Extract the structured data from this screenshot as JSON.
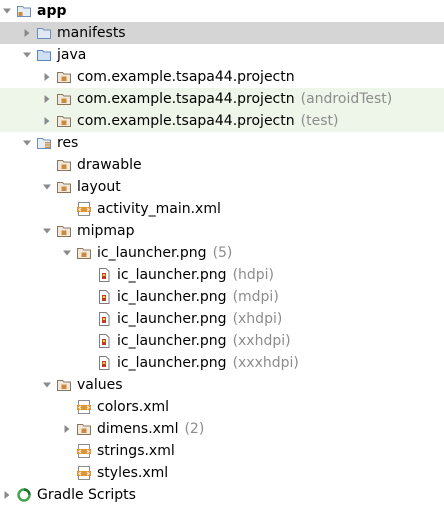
{
  "colors": {
    "selected_row": "#d5d5d5",
    "test_row_highlight": "#eef6e9",
    "folder_outline": "#6e8fb5",
    "module_square": "#ce8a3c",
    "gradle_green": "#3ea64b",
    "secondary_text": "#8c8c8c"
  },
  "tree": [
    {
      "id": "app",
      "label": "app",
      "suffix": "",
      "icon": "module-folder-icon",
      "arrow": "expanded",
      "depth": 0,
      "bold": true,
      "state": ""
    },
    {
      "id": "manifests",
      "label": "manifests",
      "suffix": "",
      "icon": "folder-icon",
      "arrow": "collapsed",
      "depth": 1,
      "bold": false,
      "state": "selected"
    },
    {
      "id": "java",
      "label": "java",
      "suffix": "",
      "icon": "source-folder-icon",
      "arrow": "expanded",
      "depth": 1,
      "bold": false,
      "state": ""
    },
    {
      "id": "pkg-main",
      "label": "com.example.tsapa44.projectn",
      "suffix": "",
      "icon": "package-icon",
      "arrow": "collapsed",
      "depth": 2,
      "bold": false,
      "state": ""
    },
    {
      "id": "pkg-android-test",
      "label": "com.example.tsapa44.projectn",
      "suffix": "(androidTest)",
      "icon": "package-icon",
      "arrow": "collapsed",
      "depth": 2,
      "bold": false,
      "state": "highlight"
    },
    {
      "id": "pkg-test",
      "label": "com.example.tsapa44.projectn",
      "suffix": "(test)",
      "icon": "package-icon",
      "arrow": "collapsed",
      "depth": 2,
      "bold": false,
      "state": "highlight"
    },
    {
      "id": "res",
      "label": "res",
      "suffix": "",
      "icon": "resource-folder-icon",
      "arrow": "expanded",
      "depth": 1,
      "bold": false,
      "state": ""
    },
    {
      "id": "drawable",
      "label": "drawable",
      "suffix": "",
      "icon": "package-icon",
      "arrow": "none",
      "depth": 2,
      "bold": false,
      "state": ""
    },
    {
      "id": "layout",
      "label": "layout",
      "suffix": "",
      "icon": "package-icon",
      "arrow": "expanded",
      "depth": 2,
      "bold": false,
      "state": ""
    },
    {
      "id": "activity-main",
      "label": "activity_main.xml",
      "suffix": "",
      "icon": "xml-file-icon",
      "arrow": "none",
      "depth": 3,
      "bold": false,
      "state": ""
    },
    {
      "id": "mipmap",
      "label": "mipmap",
      "suffix": "",
      "icon": "package-icon",
      "arrow": "expanded",
      "depth": 2,
      "bold": false,
      "state": ""
    },
    {
      "id": "ic-launcher-group",
      "label": "ic_launcher.png",
      "suffix": "(5)",
      "icon": "package-icon",
      "arrow": "expanded",
      "depth": 3,
      "bold": false,
      "state": ""
    },
    {
      "id": "ic-hdpi",
      "label": "ic_launcher.png",
      "suffix": "(hdpi)",
      "icon": "image-file-icon",
      "arrow": "none",
      "depth": 4,
      "bold": false,
      "state": ""
    },
    {
      "id": "ic-mdpi",
      "label": "ic_launcher.png",
      "suffix": "(mdpi)",
      "icon": "image-file-icon",
      "arrow": "none",
      "depth": 4,
      "bold": false,
      "state": ""
    },
    {
      "id": "ic-xhdpi",
      "label": "ic_launcher.png",
      "suffix": "(xhdpi)",
      "icon": "image-file-icon",
      "arrow": "none",
      "depth": 4,
      "bold": false,
      "state": ""
    },
    {
      "id": "ic-xxhdpi",
      "label": "ic_launcher.png",
      "suffix": "(xxhdpi)",
      "icon": "image-file-icon",
      "arrow": "none",
      "depth": 4,
      "bold": false,
      "state": ""
    },
    {
      "id": "ic-xxxhdpi",
      "label": "ic_launcher.png",
      "suffix": "(xxxhdpi)",
      "icon": "image-file-icon",
      "arrow": "none",
      "depth": 4,
      "bold": false,
      "state": ""
    },
    {
      "id": "values",
      "label": "values",
      "suffix": "",
      "icon": "package-icon",
      "arrow": "expanded",
      "depth": 2,
      "bold": false,
      "state": ""
    },
    {
      "id": "colors-xml",
      "label": "colors.xml",
      "suffix": "",
      "icon": "xml-file-icon",
      "arrow": "none",
      "depth": 3,
      "bold": false,
      "state": ""
    },
    {
      "id": "dimens-xml",
      "label": "dimens.xml",
      "suffix": "(2)",
      "icon": "package-icon",
      "arrow": "collapsed",
      "depth": 3,
      "bold": false,
      "state": ""
    },
    {
      "id": "strings-xml",
      "label": "strings.xml",
      "suffix": "",
      "icon": "xml-file-icon",
      "arrow": "none",
      "depth": 3,
      "bold": false,
      "state": ""
    },
    {
      "id": "styles-xml",
      "label": "styles.xml",
      "suffix": "",
      "icon": "xml-file-icon",
      "arrow": "none",
      "depth": 3,
      "bold": false,
      "state": ""
    },
    {
      "id": "gradle-scripts",
      "label": "Gradle Scripts",
      "suffix": "",
      "icon": "gradle-icon",
      "arrow": "collapsed",
      "depth": 0,
      "bold": false,
      "state": ""
    }
  ]
}
